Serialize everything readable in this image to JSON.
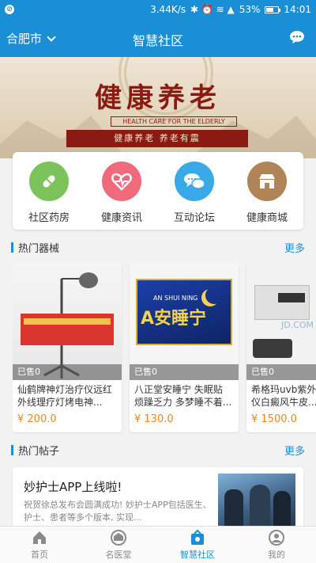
{
  "status_bar": {
    "speed": "3.44K/s",
    "battery": "53%",
    "time": "14:01"
  },
  "navbar": {
    "city": "合肥市",
    "title": "智慧社区"
  },
  "banner": {
    "title": "健康养老",
    "subtitle": "HEALTH CARE FOR THE ELDERLY",
    "slogan": "健康养老  养老有震"
  },
  "features": [
    {
      "label": "社区药房",
      "icon": "pill-icon",
      "color": "#7dc35b"
    },
    {
      "label": "健康资讯",
      "icon": "heart-pulse-icon",
      "color": "#f06a7b"
    },
    {
      "label": "互动论坛",
      "icon": "chat-bubbles-icon",
      "color": "#39a9e8"
    },
    {
      "label": "健康商城",
      "icon": "store-icon",
      "color": "#b08457"
    }
  ],
  "hot_devices": {
    "title": "热门器械",
    "more": "更多"
  },
  "products": [
    {
      "sold": "已售0",
      "name": "仙鹤牌神灯治疗仪远红外线理疗灯烤电神...",
      "price": "¥ 200.0"
    },
    {
      "sold": "已售0",
      "name": "八正堂安睡宁 失眠贴 烦躁乏力 多梦睡不着...",
      "price": "¥ 130.0",
      "img_text": "A安睡宁",
      "img_sub": "AN SHUI NING"
    },
    {
      "sold": "已售0",
      "name": "希格玛uvb紫外线治疗仪白癜风牛皮...",
      "price": "¥ 1500.0",
      "img_text": "JD.COM"
    }
  ],
  "hot_posts": {
    "title": "热门帖子",
    "more": "更多"
  },
  "post": {
    "title": "妙护士APP上线啦!",
    "desc": "祝贺徐总发布会圆满成功! 妙护士APP包括医生、护士、患者等多个版本, 实现..."
  },
  "tabs": [
    {
      "label": "首页",
      "icon": "home-icon"
    },
    {
      "label": "名医堂",
      "icon": "doctor-hall-icon"
    },
    {
      "label": "智慧社区",
      "icon": "community-icon",
      "active": true
    },
    {
      "label": "我的",
      "icon": "profile-icon"
    }
  ]
}
